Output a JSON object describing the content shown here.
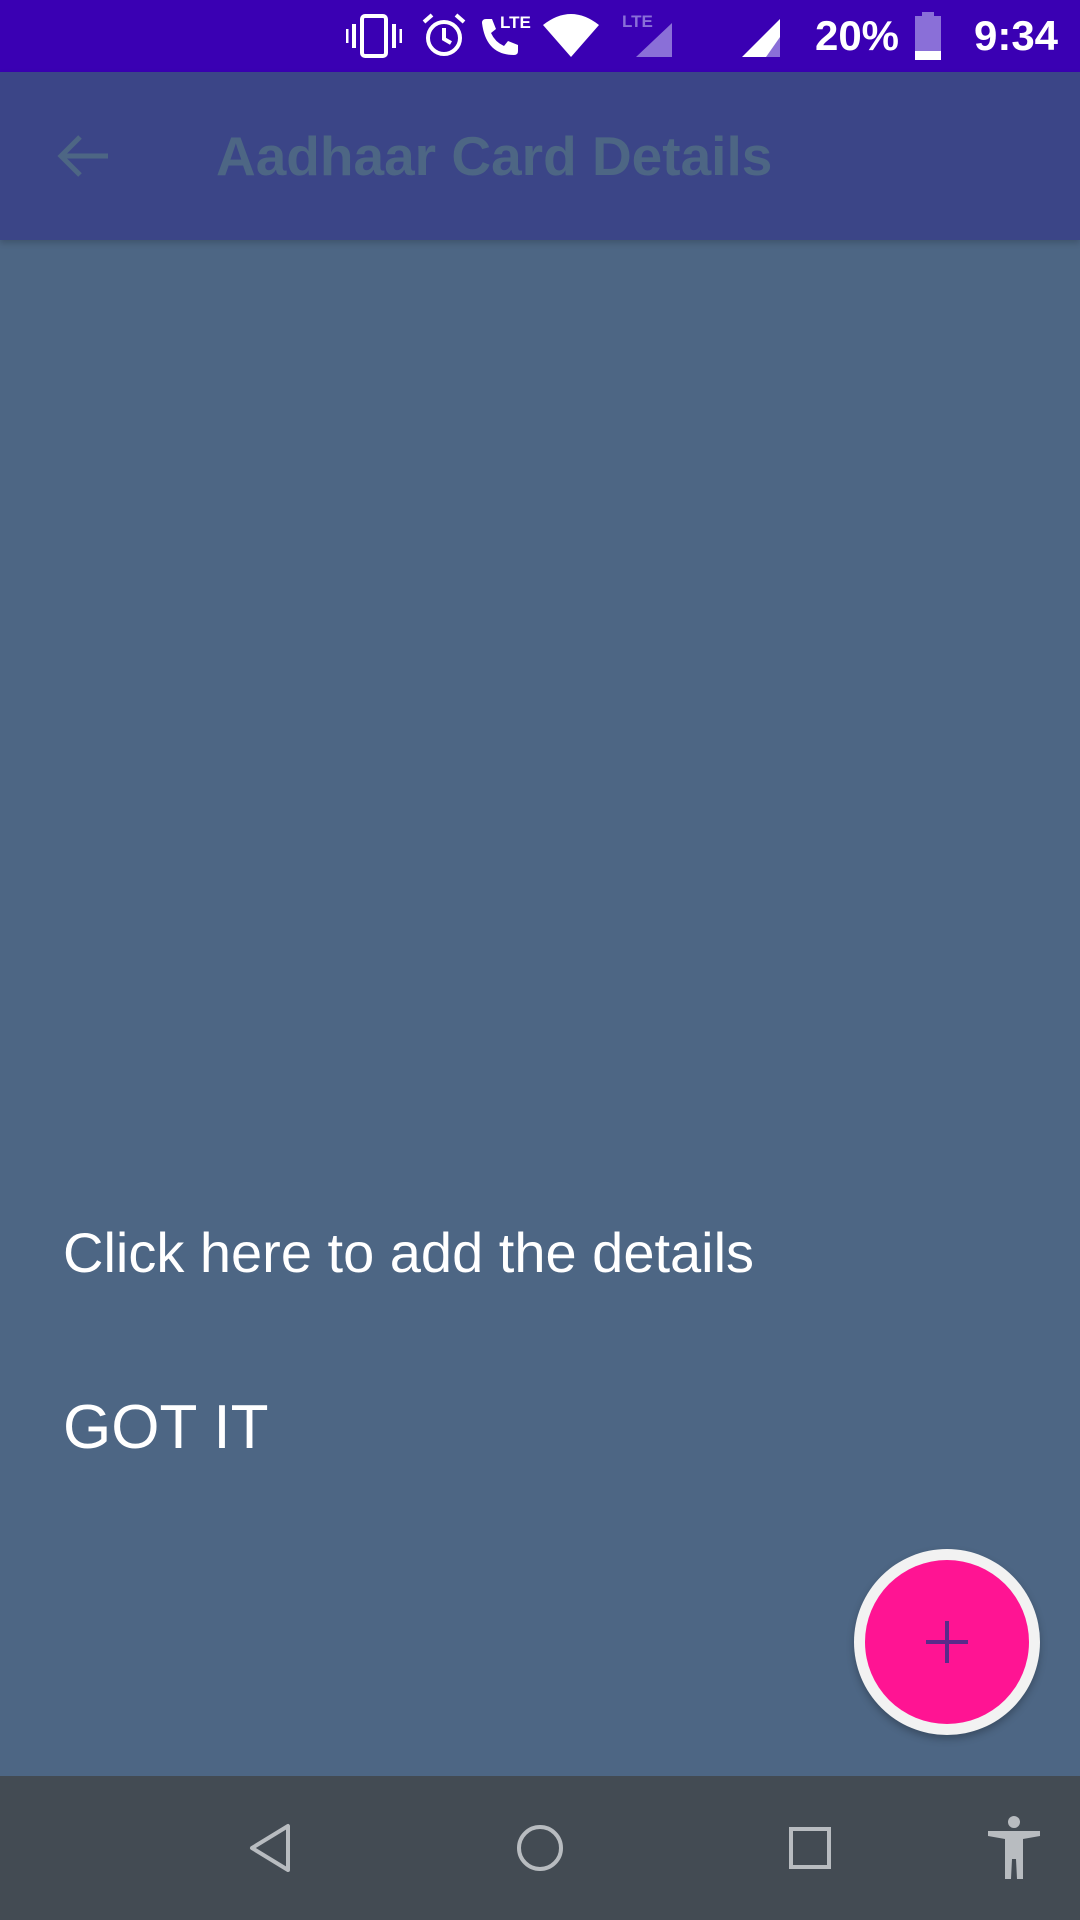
{
  "status_bar": {
    "battery_percent": "20%",
    "time": "9:34",
    "lte_label": "LTE",
    "colors": {
      "background": "#3a00b3"
    },
    "icons": [
      "vibrate-icon",
      "alarm-icon",
      "lte-call-icon",
      "wifi-icon",
      "lte-signal-icon",
      "signal-icon",
      "battery-icon"
    ]
  },
  "app_bar": {
    "title": "Aadhaar Card Details",
    "back_icon": "arrow-back-icon",
    "colors": {
      "background": "#3b4587",
      "title": "#4d6684"
    }
  },
  "overlay": {
    "hint": "Click here to add the details",
    "dismiss_label": "GOT IT",
    "colors": {
      "background": "#4d6684",
      "text": "#ffffff"
    }
  },
  "fab": {
    "icon": "add-icon",
    "colors": {
      "background": "#ff1493",
      "ring": "#f2f2f2",
      "icon": "#5a2a8a"
    }
  },
  "nav_bar": {
    "icons": [
      "nav-back-icon",
      "nav-home-icon",
      "nav-recents-icon",
      "accessibility-icon"
    ],
    "colors": {
      "background": "#434b53"
    }
  }
}
